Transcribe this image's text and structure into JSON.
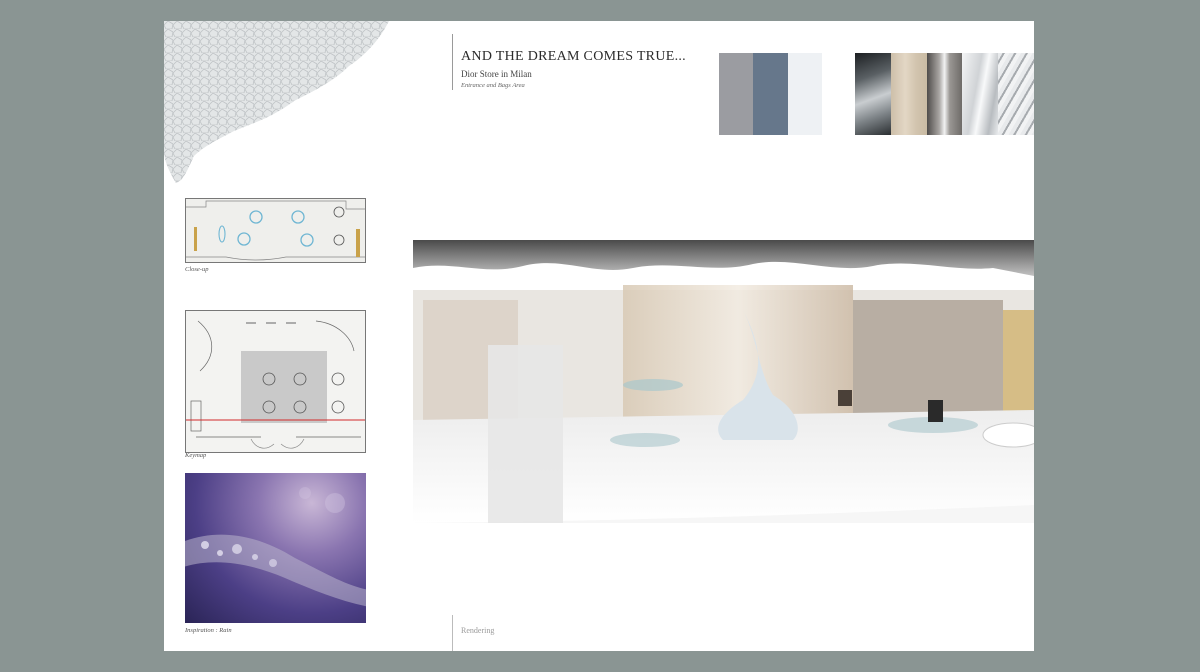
{
  "header": {
    "title": "AND THE DREAM COMES TRUE...",
    "subtitle": "Dior Store in Milan",
    "section": "Entrance and Bags Area"
  },
  "palette": {
    "colors": [
      "#9b9ca1",
      "#66778b",
      "#eef1f4"
    ]
  },
  "materials": {
    "tones": [
      "#2a2e31",
      "#d8cbb8",
      "#8e8a86",
      "#d6d9dc",
      "#b4b8bc"
    ]
  },
  "panels": {
    "closeup_caption": "Close-up",
    "keymap_caption": "Keymap",
    "inspiration_caption": "Inspiration : Rain"
  },
  "footer": {
    "label": "Rendering"
  }
}
